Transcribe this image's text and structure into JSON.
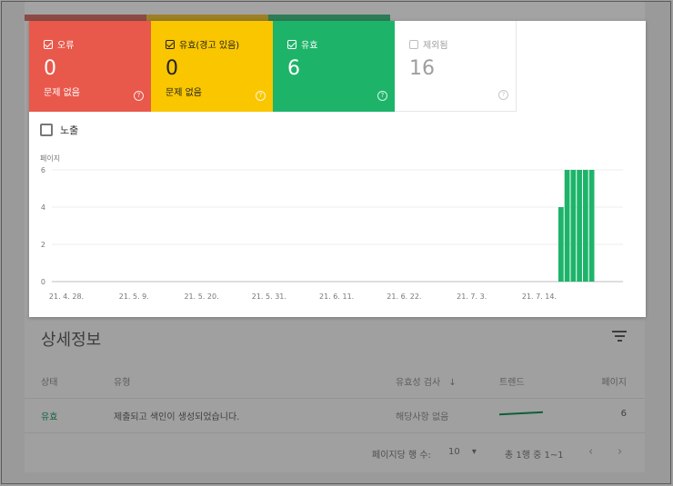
{
  "colors": {
    "error": "#e8584b",
    "warning": "#f9c600",
    "valid": "#1db46a",
    "excluded_text": "#9e9e9e",
    "stripe_error": "#8c4a45",
    "stripe_warning": "#9c8024",
    "stripe_valid": "#2c7c56"
  },
  "tiles": [
    {
      "label": "오류",
      "count": "0",
      "sub": "문제 없음",
      "checked": true
    },
    {
      "label": "유효(경고 있음)",
      "count": "0",
      "sub": "문제 없음",
      "checked": true
    },
    {
      "label": "유효",
      "count": "6",
      "sub": "",
      "checked": true
    },
    {
      "label": "제외됨",
      "count": "16",
      "sub": "",
      "checked": false
    }
  ],
  "impressions_label": "노출",
  "chart_data": {
    "type": "bar",
    "ylabel": "페이지",
    "ylim": [
      0,
      6
    ],
    "yticks": [
      0,
      2,
      4,
      6
    ],
    "xtick_labels": [
      "21. 4. 28.",
      "21. 5. 9.",
      "21. 5. 20.",
      "21. 5. 31.",
      "21. 6. 11.",
      "21. 6. 22.",
      "21. 7. 3.",
      "21. 7. 14."
    ],
    "start_date": "2021-04-28",
    "days_shown": 89,
    "series": [
      {
        "values_by_day_index": {
          "81": 4,
          "82": 6,
          "83": 6,
          "84": 6,
          "85": 6,
          "86": 6
        }
      }
    ]
  },
  "details": {
    "title": "상세정보",
    "columns": [
      "상태",
      "유형",
      "유효성 검사",
      "트렌드",
      "페이지"
    ],
    "rows": [
      {
        "status": "유효",
        "type": "제출되고 색인이 생성되었습니다.",
        "validation": "해당사항 없음",
        "pages": "6"
      }
    ],
    "rows_per_page_label": "페이지당 행 수:",
    "rows_per_page": "10",
    "range_label": "총 1행 중 1~1"
  }
}
